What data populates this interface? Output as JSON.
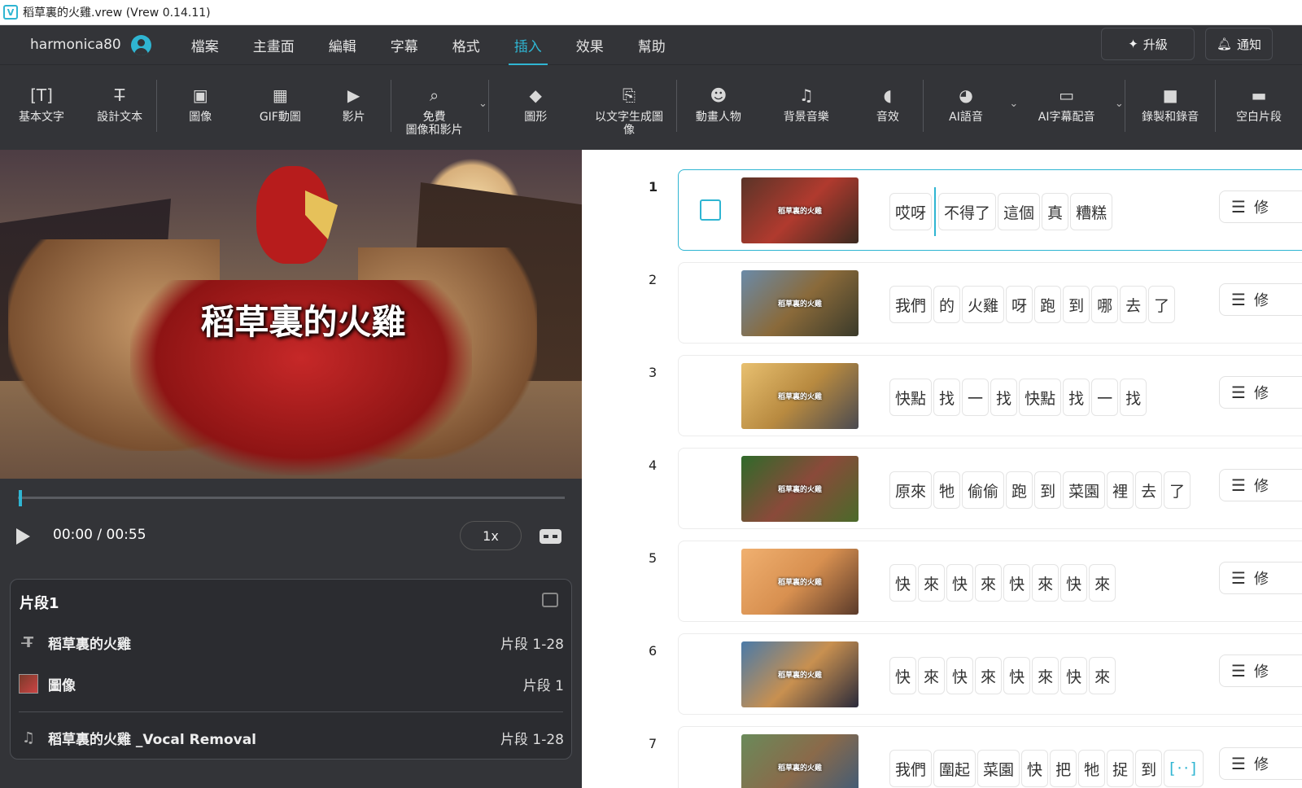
{
  "window": {
    "title": "稻草裏的火雞.vrew (Vrew 0.14.11)",
    "logo": "V"
  },
  "menubar": {
    "username": "harmonica80",
    "menus": [
      "檔案",
      "主畫面",
      "編輯",
      "字幕",
      "格式",
      "插入",
      "效果",
      "幫助"
    ],
    "active_menu": "插入",
    "upgrade_label": "升級",
    "notify_label": "通知"
  },
  "toolbar": {
    "items": [
      {
        "label": "基本文字",
        "icon": "text-box-icon"
      },
      {
        "label": "設計文本",
        "icon": "design-text-icon"
      },
      {
        "label": "圖像",
        "icon": "image-icon"
      },
      {
        "label": "GIF動圖",
        "icon": "gif-icon"
      },
      {
        "label": "影片",
        "icon": "video-icon"
      },
      {
        "label": "免費\n圖像和影片",
        "icon": "free-media-icon"
      },
      {
        "label": "圖形",
        "icon": "shapes-icon"
      },
      {
        "label": "以文字生成圖\n像",
        "icon": "text-to-image-icon"
      },
      {
        "label": "動畫人物",
        "icon": "animated-character-icon"
      },
      {
        "label": "背景音樂",
        "icon": "music-note-icon"
      },
      {
        "label": "音效",
        "icon": "sound-effect-icon"
      },
      {
        "label": "AI語音",
        "icon": "ai-voice-icon"
      },
      {
        "label": "AI字幕配音",
        "icon": "ai-dubbing-icon"
      },
      {
        "label": "錄製和錄音",
        "icon": "camera-icon"
      },
      {
        "label": "空白片段",
        "icon": "blank-clip-icon"
      }
    ]
  },
  "preview": {
    "title_overlay": "稻草裏的火雞",
    "progress": 0.0,
    "time": "00:00 / 00:55",
    "speed": "1x"
  },
  "clip_panel": {
    "title": "片段1",
    "rows": [
      {
        "label": "稻草裏的火雞",
        "range": "片段 1-28",
        "icon": "design-text-icon"
      },
      {
        "label": "圖像",
        "range": "片段 1",
        "icon": "image-thumbnail"
      },
      {
        "label": "稻草裏的火雞 _Vocal Removal",
        "range": "片段 1-28",
        "icon": "music-note-icon"
      }
    ]
  },
  "segments": [
    {
      "num": "1",
      "thumb_text": "稻草裏的火雞",
      "words": [
        "哎呀",
        "不得了",
        "這個",
        "真",
        "糟糕"
      ],
      "selected": true,
      "colors": [
        "#5a3428",
        "#b03a2e",
        "#3a2a20"
      ]
    },
    {
      "num": "2",
      "thumb_text": "稻草裏的火雞",
      "words": [
        "我們",
        "的",
        "火雞",
        "呀",
        "跑",
        "到",
        "哪",
        "去",
        "了"
      ],
      "selected": false,
      "colors": [
        "#6a8aa8",
        "#8a6a3a",
        "#3a3a2a"
      ]
    },
    {
      "num": "3",
      "thumb_text": "稻草裏的火雞",
      "words": [
        "快點",
        "找",
        "一",
        "找",
        "快點",
        "找",
        "一",
        "找"
      ],
      "selected": false,
      "colors": [
        "#e8c070",
        "#b88a40",
        "#4a4a50"
      ]
    },
    {
      "num": "4",
      "thumb_text": "稻草裏的火雞",
      "words": [
        "原來",
        "牠",
        "偷偷",
        "跑",
        "到",
        "菜園",
        "裡",
        "去",
        "了"
      ],
      "selected": false,
      "colors": [
        "#2f6a2a",
        "#8a4a3a",
        "#4a6a2a"
      ]
    },
    {
      "num": "5",
      "thumb_text": "稻草裏的火雞",
      "words": [
        "快",
        "來",
        "快",
        "來",
        "快",
        "來",
        "快",
        "來"
      ],
      "selected": false,
      "colors": [
        "#f0b070",
        "#d89050",
        "#5a3a2a"
      ]
    },
    {
      "num": "6",
      "thumb_text": "稻草裏的火雞",
      "words": [
        "快",
        "來",
        "快",
        "來",
        "快",
        "來",
        "快",
        "來"
      ],
      "selected": false,
      "colors": [
        "#4a7aa8",
        "#c89050",
        "#2a2a3a"
      ]
    },
    {
      "num": "7",
      "thumb_text": "稻草裏的火雞",
      "words": [
        "我們",
        "圍起",
        "菜園",
        "快",
        "把",
        "牠",
        "捉",
        "到"
      ],
      "selected": false,
      "more": "[··]",
      "colors": [
        "#6a8a5a",
        "#8a6a4a",
        "#3a5a7a"
      ]
    }
  ],
  "segment_tool_label": "修",
  "colors": {
    "accent": "#2fb5d2",
    "dark_bg": "#333438"
  }
}
